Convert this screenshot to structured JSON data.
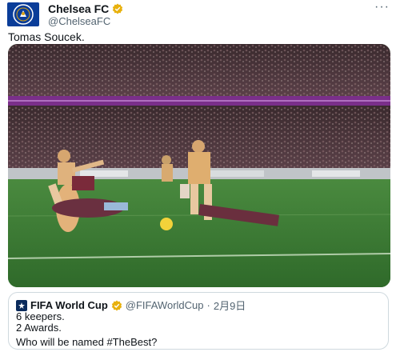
{
  "tweet": {
    "display_name": "Chelsea FC",
    "handle": "@ChelseaFC",
    "more_label": "···",
    "text": "Tomas Soucek."
  },
  "quote": {
    "display_name": "FIFA World Cup",
    "handle": "@FIFAWorldCup",
    "separator": "·",
    "date": "2月9日",
    "lines": [
      "6 keepers.",
      "2 Awards.",
      "Who will be named #TheBest?"
    ]
  },
  "media": {
    "description_icon": "football-video-still"
  },
  "colors": {
    "verified_badge": "#e8b10d",
    "chelsea_blue": "#0a3d99",
    "pitch_green": "#3b7a35"
  }
}
